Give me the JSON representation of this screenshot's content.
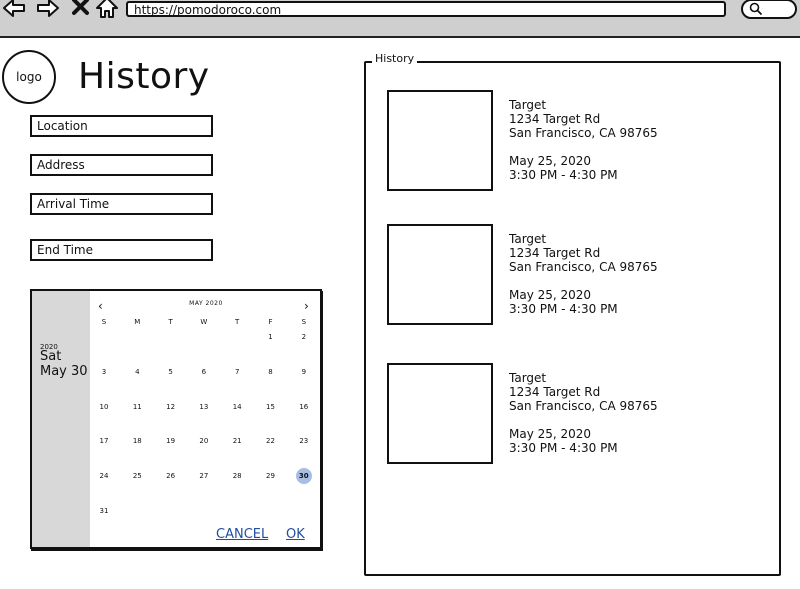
{
  "browser": {
    "url": "https://pomodoroco.com"
  },
  "logo": {
    "label": "logo"
  },
  "page": {
    "title": "History"
  },
  "form": {
    "location": "Location",
    "address": "Address",
    "arrival_time": "Arrival Time",
    "end_time": "End Time"
  },
  "date_picker": {
    "year": "2020",
    "weekday": "Sat",
    "date": "May 30",
    "month_label": "MAY 2020",
    "weekdays": [
      "S",
      "M",
      "T",
      "W",
      "T",
      "F",
      "S"
    ],
    "first_weekday_index": 5,
    "days_in_month": 31,
    "selected_day": 30,
    "cancel_label": "CANCEL",
    "ok_label": "OK",
    "selected_color": "#a7bde3"
  },
  "history": {
    "legend": "History",
    "entries": [
      {
        "name": "Target",
        "street": "1234 Target Rd",
        "city": "San Francisco, CA 98765",
        "date": "May 25, 2020",
        "time": "3:30 PM - 4:30 PM"
      },
      {
        "name": "Target",
        "street": "1234 Target Rd",
        "city": "San Francisco, CA 98765",
        "date": "May 25, 2020",
        "time": "3:30 PM - 4:30 PM"
      },
      {
        "name": "Target",
        "street": "1234 Target Rd",
        "city": "San Francisco, CA 98765",
        "date": "May 25, 2020",
        "time": "3:30 PM - 4:30 PM"
      }
    ]
  }
}
